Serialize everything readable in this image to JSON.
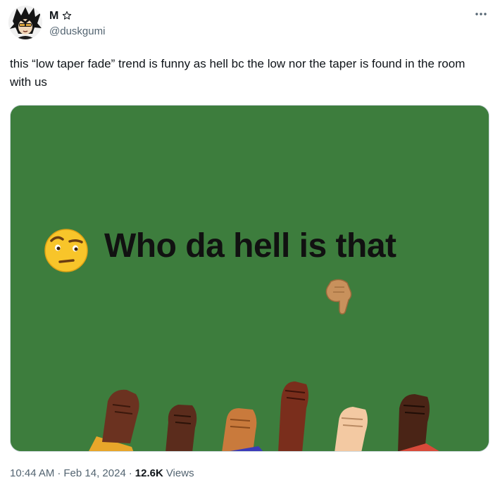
{
  "author": {
    "display_name": "M",
    "handle": "@duskgumi"
  },
  "icons": {
    "star": "star-outline-icon",
    "more": "more-horizontal-icon"
  },
  "tweet": {
    "text": "this “low taper fade” trend is funny as hell bc the low nor the taper is found in the room with us"
  },
  "media": {
    "caption": "Who da hell is that",
    "background_color": "#3d7d3d"
  },
  "meta": {
    "time": "10:44 AM",
    "separator": "·",
    "date": "Feb 14, 2024",
    "views_count": "12.6K",
    "views_label": "Views"
  }
}
